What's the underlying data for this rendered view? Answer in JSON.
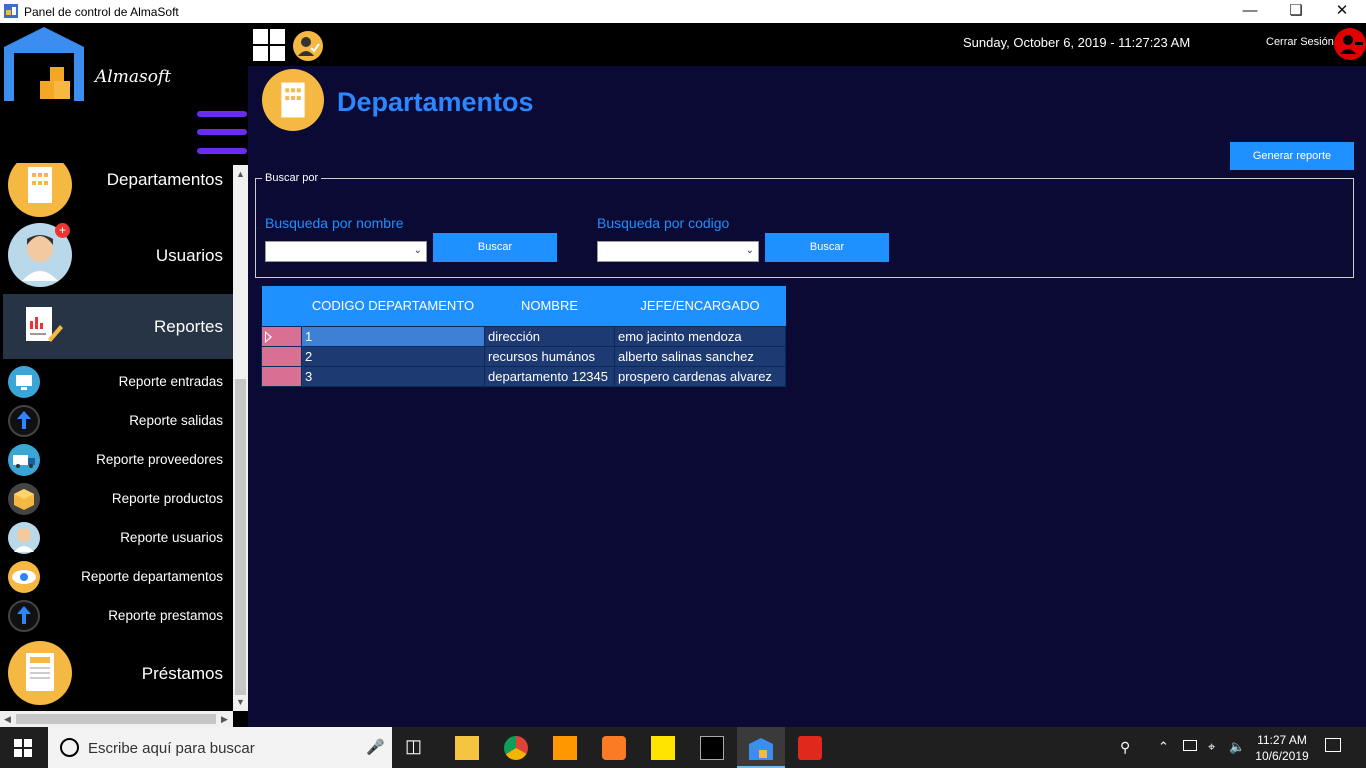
{
  "window": {
    "title": "Panel de control de AlmaSoft"
  },
  "brand": {
    "name": "Almasoft"
  },
  "topbar": {
    "datetime": "Sunday, October 6, 2019 - 11:27:23 AM",
    "logout_label": "Cerrar Sesión"
  },
  "sidebar": {
    "items": [
      {
        "label": "Departamentos",
        "icon": "building-icon"
      },
      {
        "label": "Usuarios",
        "icon": "user-icon"
      },
      {
        "label": "Reportes",
        "icon": "report-icon"
      }
    ],
    "subitems": [
      {
        "label": "Reporte entradas",
        "icon": "monitor-icon"
      },
      {
        "label": "Reporte salidas",
        "icon": "up-arrow-icon"
      },
      {
        "label": "Reporte proveedores",
        "icon": "truck-icon"
      },
      {
        "label": "Reporte productos",
        "icon": "box-icon"
      },
      {
        "label": "Reporte usuarios",
        "icon": "user-icon"
      },
      {
        "label": "Reporte departamentos",
        "icon": "eye-icon"
      },
      {
        "label": "Reporte prestamos",
        "icon": "up-arrow-icon"
      }
    ],
    "footer_item": {
      "label": "Préstamos",
      "icon": "loan-icon"
    }
  },
  "page": {
    "title": "Departamentos",
    "report_button": "Generar reporte"
  },
  "search": {
    "legend": "Buscar por",
    "by_name_label": "Busqueda por nombre",
    "by_code_label": "Busqueda por codigo",
    "search_button": "Buscar"
  },
  "table": {
    "columns": [
      "CODIGO DEPARTAMENTO",
      "NOMBRE",
      "JEFE/ENCARGADO"
    ],
    "rows": [
      [
        "1",
        "dirección",
        "emo jacinto mendoza"
      ],
      [
        "2",
        "recursos humános",
        "alberto salinas sanchez"
      ],
      [
        "3",
        "departamento 12345",
        "prospero cardenas alvarez"
      ]
    ]
  },
  "taskbar": {
    "search_placeholder": "Escribe aquí para buscar",
    "time": "11:27 AM",
    "date": "10/6/2019"
  },
  "colors": {
    "accent": "#1e90ff",
    "background": "#0a0a35",
    "row_header": "#d87093",
    "icon_gold": "#f5b843"
  }
}
